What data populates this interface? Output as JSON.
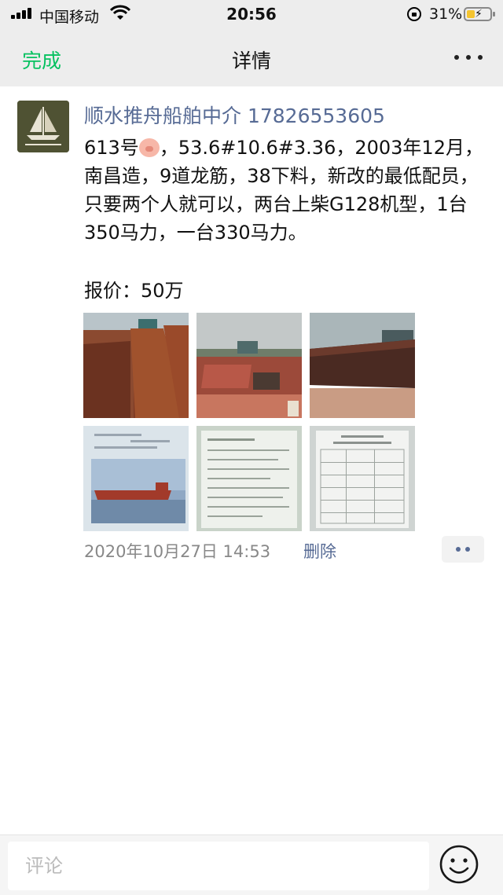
{
  "status_bar": {
    "carrier": "中国移动",
    "time": "20:56",
    "battery_percent": "31%",
    "icons": [
      "signal-icon",
      "wifi-icon",
      "orientation-lock-icon",
      "battery-charging-icon"
    ]
  },
  "nav": {
    "done_label": "完成",
    "title": "详情",
    "more_icon": "more-icon",
    "done_color": "#07c160"
  },
  "post": {
    "author": "顺水推舟船舶中介 17826553605",
    "content_before_emoji": "613号",
    "emoji": "pig-face-emoji",
    "content_after_emoji": "，53.6#10.6#3.36，2003年12月，南昌造，9道龙筋，38下料，新改的最低配员，只要两个人就可以，两台上柴G128机型，1台350马力，一台330马力。",
    "price_line": "报价：50万",
    "photos": [
      "barge-hold-photo",
      "barge-deck-photo",
      "barge-hull-photo",
      "certificate-ship-photo",
      "document-photo-1",
      "document-photo-2"
    ],
    "timestamp": "2020年10月27日 14:53",
    "delete_label": "删除",
    "link_color": "#576b95"
  },
  "comment_bar": {
    "placeholder": "评论",
    "emoji_icon": "emoji-icon"
  }
}
